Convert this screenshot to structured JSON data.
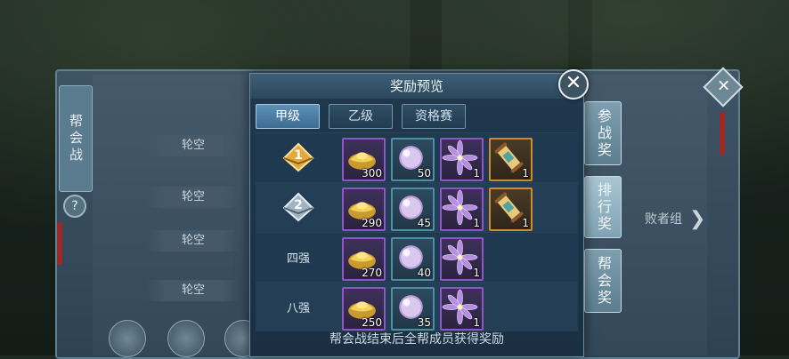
{
  "background": {
    "left_strip_label": "帮会战",
    "help_label": "?",
    "close_label": "✕",
    "bye_slots": [
      "轮空",
      "轮空",
      "轮空",
      "轮空"
    ],
    "side_tabs": [
      "参战奖",
      "排行奖",
      "帮会奖"
    ],
    "loser_bracket_label": "败者组"
  },
  "modal": {
    "title": "奖励预览",
    "close_label": "✕",
    "tabs": [
      {
        "label": "甲级",
        "active": true
      },
      {
        "label": "乙级",
        "active": false
      },
      {
        "label": "资格赛",
        "active": false
      }
    ],
    "rows": [
      {
        "rank_text": "",
        "rank_icon": "gold-rank-1-icon",
        "rank_number": "1",
        "items": [
          {
            "icon": "gold-ingot-icon",
            "qty": "300",
            "rarity": "purple"
          },
          {
            "icon": "pearl-icon",
            "qty": "50",
            "rarity": "teal"
          },
          {
            "icon": "purple-flower-icon",
            "qty": "1",
            "rarity": "purple"
          },
          {
            "icon": "scroll-icon",
            "qty": "1",
            "rarity": "orange"
          }
        ]
      },
      {
        "rank_text": "",
        "rank_icon": "silver-rank-2-icon",
        "rank_number": "2",
        "items": [
          {
            "icon": "gold-ingot-icon",
            "qty": "290",
            "rarity": "purple"
          },
          {
            "icon": "pearl-icon",
            "qty": "45",
            "rarity": "teal"
          },
          {
            "icon": "purple-flower-icon",
            "qty": "1",
            "rarity": "purple"
          },
          {
            "icon": "scroll-icon",
            "qty": "1",
            "rarity": "orange"
          }
        ]
      },
      {
        "rank_text": "四强",
        "rank_icon": "",
        "rank_number": "",
        "items": [
          {
            "icon": "gold-ingot-icon",
            "qty": "270",
            "rarity": "purple"
          },
          {
            "icon": "pearl-icon",
            "qty": "40",
            "rarity": "teal"
          },
          {
            "icon": "purple-flower-icon",
            "qty": "1",
            "rarity": "purple"
          }
        ]
      },
      {
        "rank_text": "八强",
        "rank_icon": "",
        "rank_number": "",
        "items": [
          {
            "icon": "gold-ingot-icon",
            "qty": "250",
            "rarity": "purple"
          },
          {
            "icon": "pearl-icon",
            "qty": "35",
            "rarity": "teal"
          },
          {
            "icon": "purple-flower-icon",
            "qty": "1",
            "rarity": "purple"
          }
        ]
      }
    ],
    "footer": "帮会战结束后全帮成员获得奖励"
  }
}
